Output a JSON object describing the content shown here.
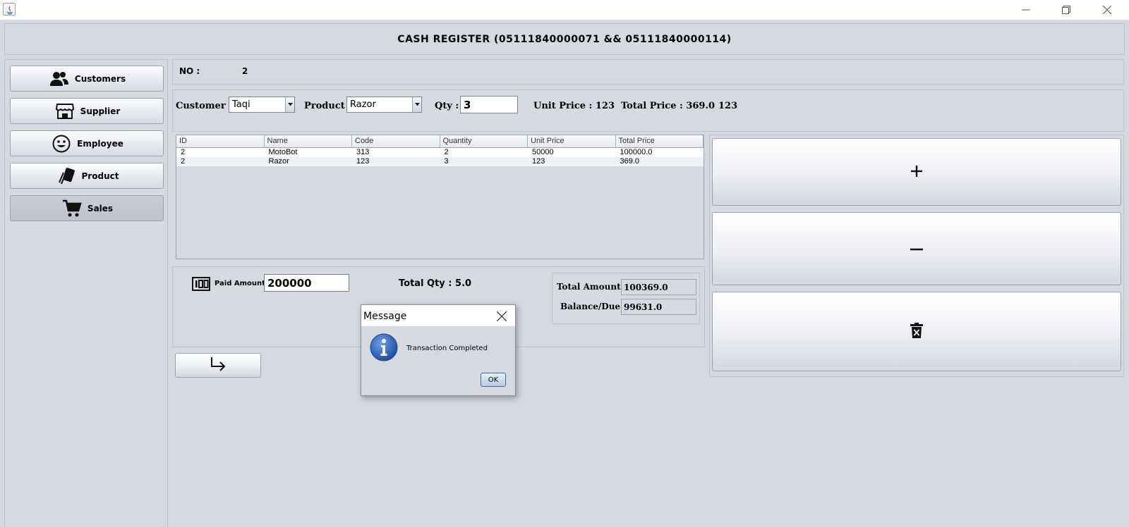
{
  "window": {
    "icon": "java-icon",
    "controls": [
      "minimize-icon",
      "restore-icon",
      "close-icon"
    ]
  },
  "header": {
    "title": "CASH REGISTER (05111840000071 && 05111840000114)"
  },
  "sidebar": {
    "items": [
      {
        "label": "Customers",
        "icon": "users-icon"
      },
      {
        "label": "Supplier",
        "icon": "store-icon"
      },
      {
        "label": "Employee",
        "icon": "smiley-icon"
      },
      {
        "label": "Product",
        "icon": "tag-icon"
      },
      {
        "label": "Sales",
        "icon": "cart-icon",
        "active": true
      }
    ]
  },
  "invoice": {
    "no_label": "NO :",
    "no_value": "2"
  },
  "form": {
    "customer_label": "Customer :",
    "customer_value": "Taqi",
    "product_label": "Product :",
    "product_value": "Razor",
    "qty_label": "Qty :",
    "qty_value": "3",
    "unit_price_text": "Unit Price : 123",
    "total_price_text": "Total Price : 369.0",
    "extra_value": "123"
  },
  "table": {
    "columns": [
      "ID",
      "Name",
      "Code",
      "Quantity",
      "Unit Price",
      "Total Price"
    ],
    "rows": [
      [
        "2",
        "MotoBot",
        "313",
        "2",
        "50000",
        "100000.0"
      ],
      [
        "2",
        "Razor",
        "123",
        "3",
        "123",
        "369.0"
      ]
    ]
  },
  "actions": {
    "add_icon": "plus-icon",
    "remove_icon": "minus-icon",
    "delete_icon": "trash-icon",
    "next_icon": "arrow-return-icon"
  },
  "payment": {
    "paid_label": "Paid Amount :",
    "paid_value": "200000",
    "total_qty_text": "Total Qty : 5.0",
    "total_amount_label": "Total Amount :",
    "total_amount_value": "100369.0",
    "balance_label": "Balance/Due :",
    "balance_value": "99631.0"
  },
  "dialog": {
    "title": "Message",
    "message": "Transaction Completed",
    "ok_label": "OK",
    "icon": "info-icon"
  }
}
